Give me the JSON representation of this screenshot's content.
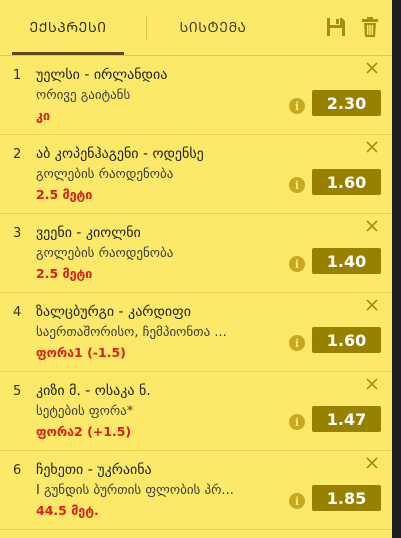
{
  "tabs": {
    "express": "ᲔᲥᲡᲞᲠᲔᲡᲘ",
    "system": "ᲡᲘᲡᲢᲔᲛᲐ"
  },
  "colors": {
    "panel_bg": "#fce96a",
    "odds_bg": "#998100",
    "pick_text": "#d6201a",
    "icon": "#a88d10"
  },
  "bets": [
    {
      "num": "1",
      "title": "უელსი - ირლანდია",
      "market": "ორივე გაიტანს",
      "pick": "კი",
      "odds": "2.30"
    },
    {
      "num": "2",
      "title": "აბ კოპენჰაგენი - ოდენსე",
      "market": "გოლების რაოდენობა",
      "pick": "2.5 მეტი",
      "odds": "1.60"
    },
    {
      "num": "3",
      "title": "ვეენი - კიოლნი",
      "market": "გოლების რაოდენობა",
      "pick": "2.5 მეტი",
      "odds": "1.40"
    },
    {
      "num": "4",
      "title": "ზალცბურგი - კარდიფი",
      "market": "საერთაშორისო, ჩემპიონთა ...",
      "pick": "ფორა1 (-1.5)",
      "odds": "1.60"
    },
    {
      "num": "5",
      "title": "კიზი მ. - ოსაკა ნ.",
      "market": "სეტების ფორა*",
      "pick": "ფორა2 (+1.5)",
      "odds": "1.47"
    },
    {
      "num": "6",
      "title": "ჩეხეთი - უკრაინა",
      "market": "I გუნდის ბურთის ფლობის პრ...",
      "pick": "44.5 მეტ.",
      "odds": "1.85"
    }
  ]
}
